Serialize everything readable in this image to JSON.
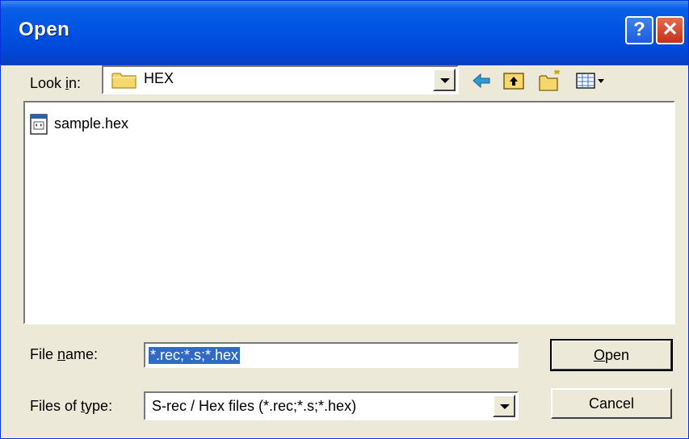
{
  "window": {
    "title": "Open",
    "help_glyph": "?",
    "close_glyph": "✕"
  },
  "lookin": {
    "label_pre": "Look ",
    "label_accel": "i",
    "label_post": "n:",
    "folder": "HEX",
    "folder_icon": "folder-icon"
  },
  "toolbar": {
    "icons": [
      "back-arrow-icon",
      "up-one-level-icon",
      "create-new-folder-icon",
      "view-menu-icon"
    ]
  },
  "files": [
    {
      "name": "sample.hex",
      "icon": "hex-file-icon"
    }
  ],
  "filename": {
    "label_pre": "File ",
    "label_accel": "n",
    "label_post": "ame:",
    "value": "*.rec;*.s;*.hex"
  },
  "filetype": {
    "label_pre": "Files of ",
    "label_accel": "t",
    "label_post": "ype:",
    "value": "S-rec / Hex files (*.rec;*.s;*.hex)"
  },
  "buttons": {
    "open_accel": "O",
    "open_rest": "pen",
    "cancel": "Cancel"
  },
  "colors": {
    "titlebar": "#0054e3",
    "selection": "#316ac5",
    "dialog_bg": "#ece9d8"
  }
}
